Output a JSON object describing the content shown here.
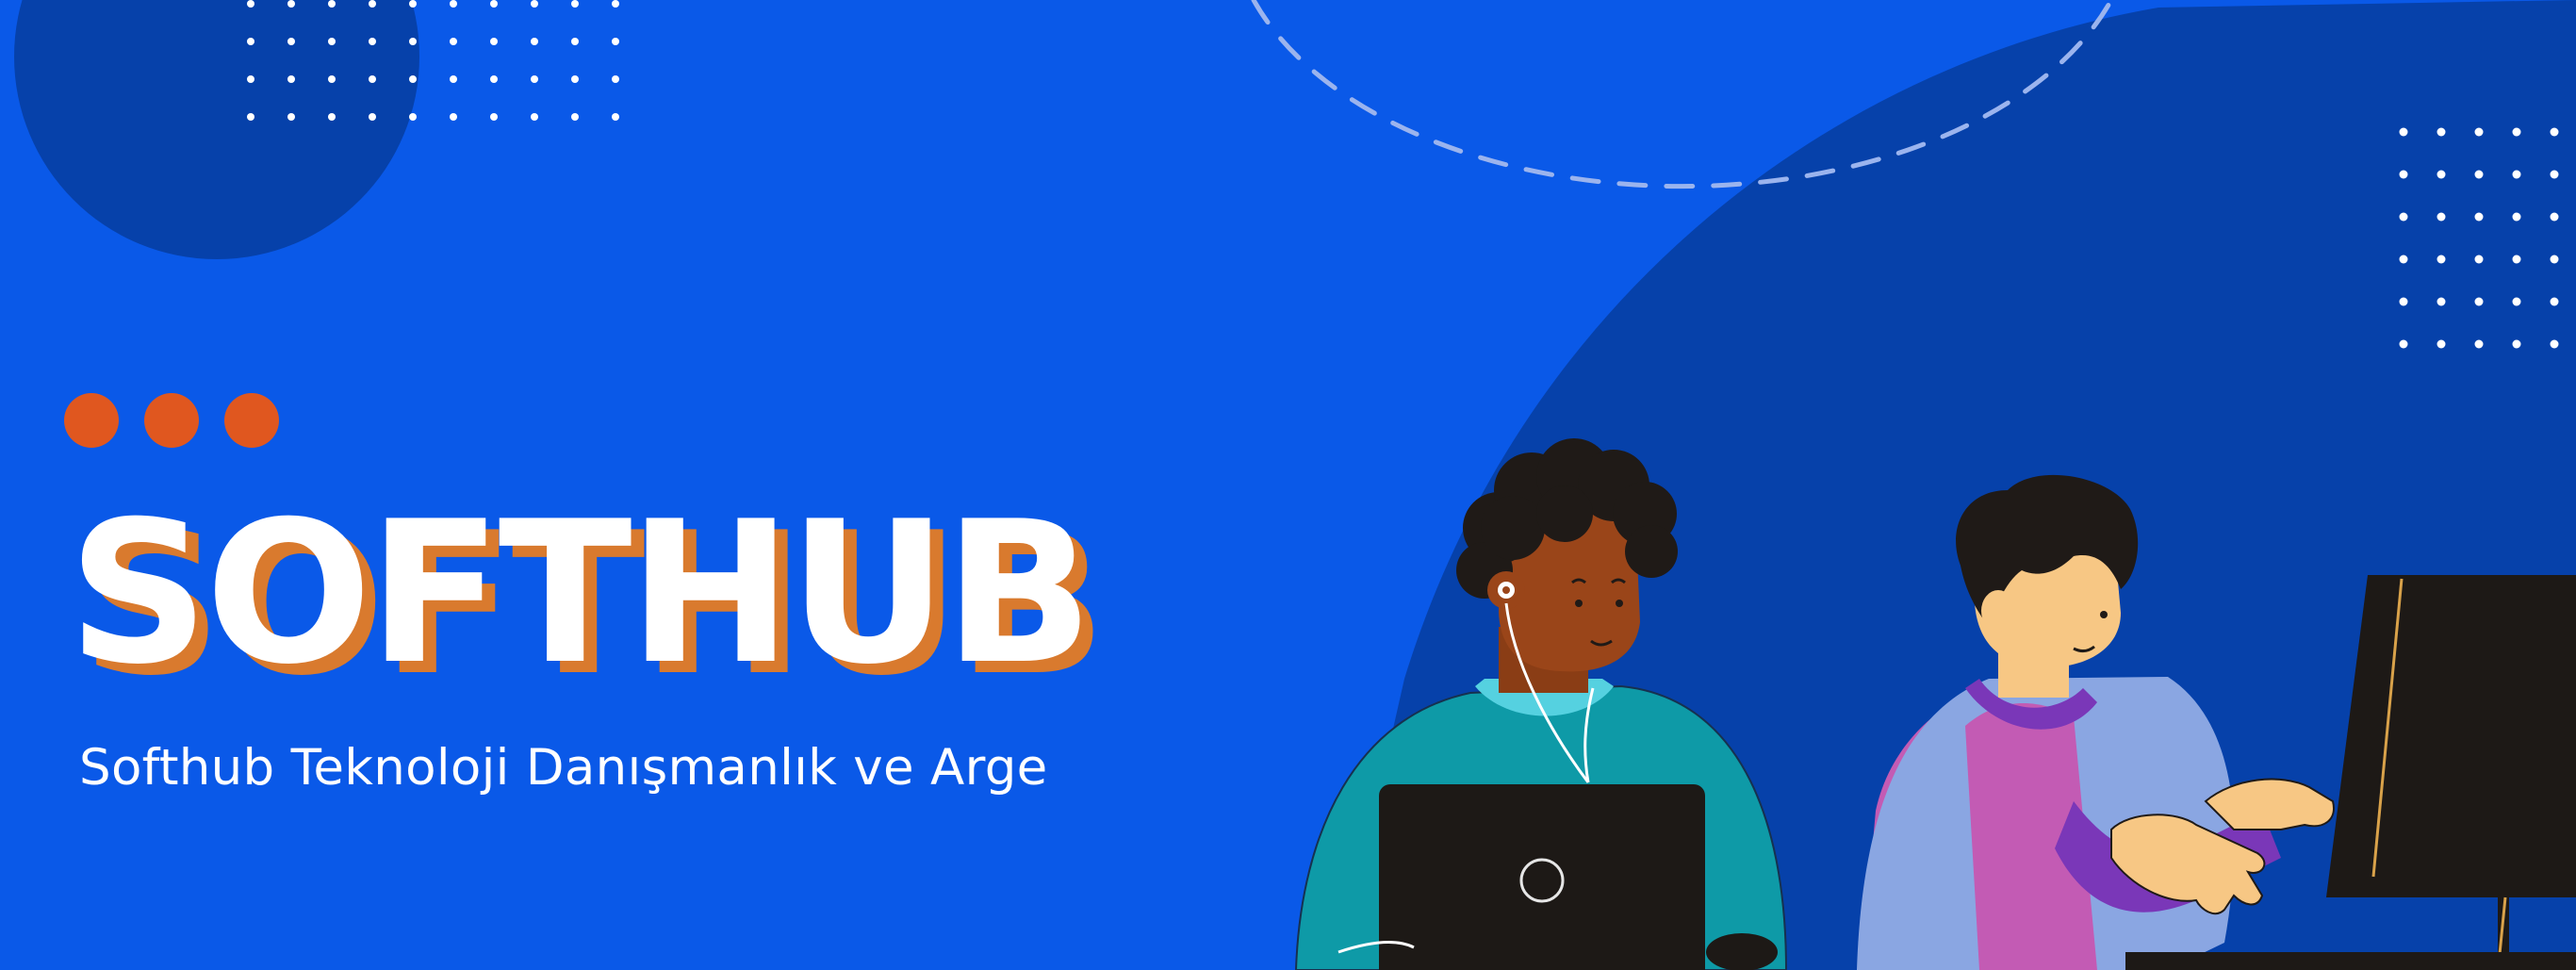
{
  "banner": {
    "title": "SOFTHUB",
    "subtitle": "Softhub Teknoloji Danışmanlık ve Arge"
  },
  "colors": {
    "background": "#0a59e8",
    "dark_blue_shape": "#0641aa",
    "accent_orange": "#e0571f",
    "title_shadow": "#d97a2e",
    "text": "#ffffff"
  },
  "icons": [
    "dot-grid-left",
    "dot-grid-right",
    "orange-dots",
    "dashed-arc",
    "person-laptop-illustration",
    "person-computer-illustration",
    "monitor-illustration"
  ]
}
